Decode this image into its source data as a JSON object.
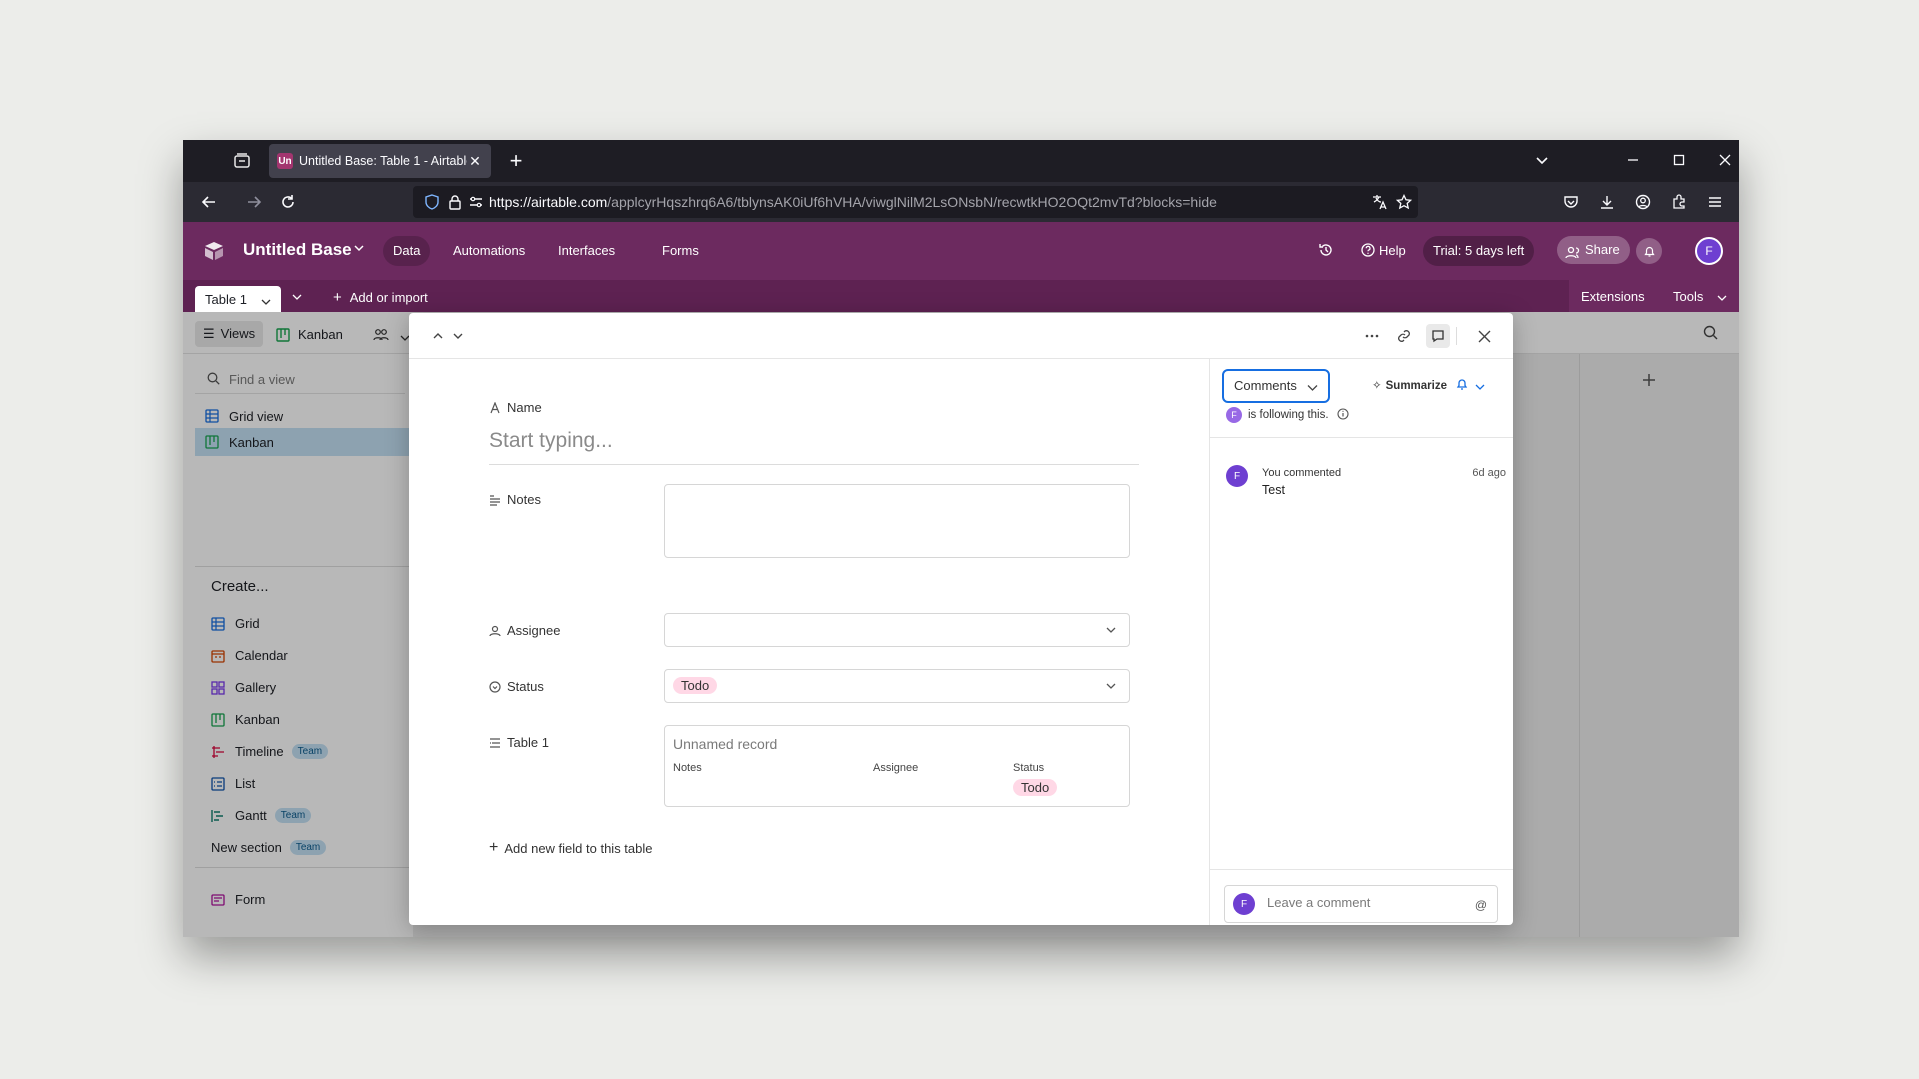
{
  "browser": {
    "tab_favicon": "Un",
    "tab_title": "Untitled Base: Table 1 - Airtable",
    "url_host": "https://airtable.com",
    "url_path": "/applcyrHqszhrq6A6/tblynsAK0iUf6hVHA/viwglNilM2LsONsbN/recwtkHO2OQt2mvTd?blocks=hide"
  },
  "app": {
    "base_name": "Untitled Base",
    "nav": [
      "Data",
      "Automations",
      "Interfaces",
      "Forms"
    ],
    "help": "Help",
    "trial": "Trial: 5 days left",
    "share": "Share",
    "user_initial": "F"
  },
  "tablebar": {
    "table_tab": "Table 1",
    "add_import": "Add or import",
    "extensions": "Extensions",
    "tools": "Tools"
  },
  "viewbar": {
    "views": "Views",
    "view_name": "Kanban"
  },
  "sidebar": {
    "find_placeholder": "Find a view",
    "views": [
      "Grid view",
      "Kanban"
    ],
    "create_label": "Create...",
    "create_items": [
      {
        "label": "Grid",
        "team": ""
      },
      {
        "label": "Calendar",
        "team": ""
      },
      {
        "label": "Gallery",
        "team": ""
      },
      {
        "label": "Kanban",
        "team": ""
      },
      {
        "label": "Timeline",
        "team": "Team"
      },
      {
        "label": "List",
        "team": ""
      },
      {
        "label": "Gantt",
        "team": "Team"
      },
      {
        "label": "New section",
        "team": "Team"
      }
    ],
    "form": "Form"
  },
  "record": {
    "name_label": "Name",
    "name_placeholder": "Start typing...",
    "notes_label": "Notes",
    "assignee_label": "Assignee",
    "status_label": "Status",
    "status_value": "Todo",
    "table1_label": "Table 1",
    "linked": {
      "title": "Unnamed record",
      "col_notes": "Notes",
      "col_assignee": "Assignee",
      "col_status": "Status",
      "status_value": "Todo"
    },
    "add_field": "Add new field to this table"
  },
  "comments": {
    "selector": "Comments",
    "summarize": "Summarize",
    "follow_initial": "F",
    "following_text": "is following this.",
    "items": [
      {
        "initial": "F",
        "author": "You commented",
        "time": "6d ago",
        "text": "Test"
      }
    ],
    "input_placeholder": "Leave a comment",
    "mention_symbol": "@"
  },
  "colors": {
    "header": "#6c2a5f",
    "accent": "#166ee1",
    "pill": "#ffd8e6"
  }
}
